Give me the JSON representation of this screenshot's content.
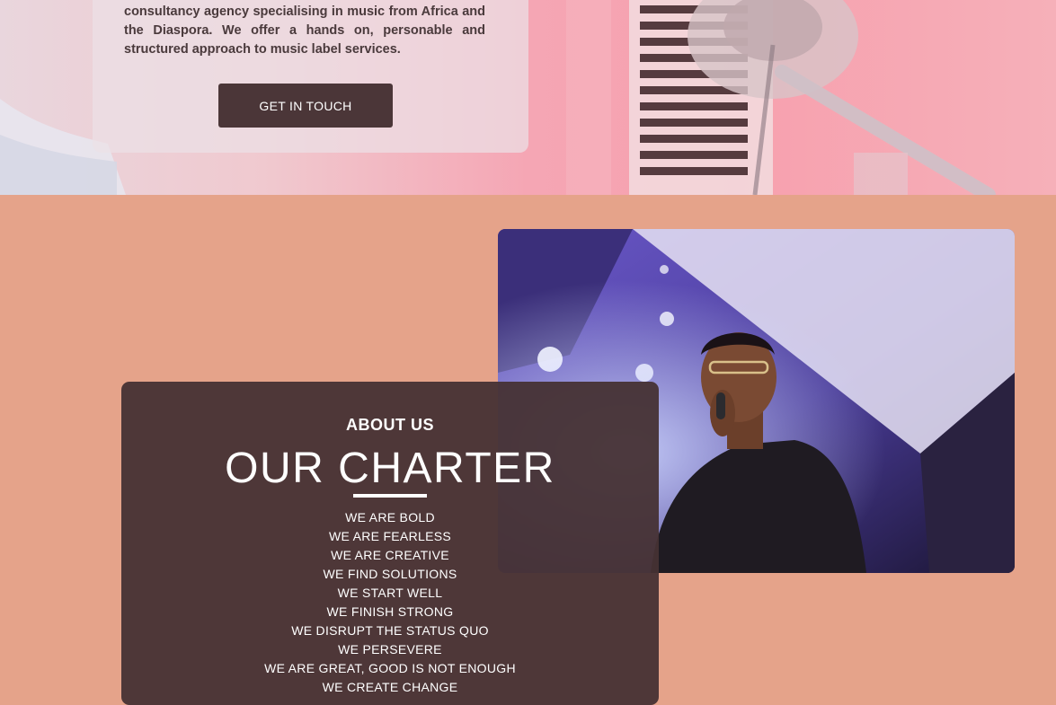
{
  "hero": {
    "intro_text": "consultancy agency specialising in music from Africa and the Diaspora. We offer a hands on, personable and structured approach to music label services.",
    "cta_label": "GET IN TOUCH"
  },
  "charter": {
    "eyebrow": "ABOUT US",
    "title": "OUR CHARTER",
    "values": [
      "WE ARE BOLD",
      "WE ARE FEARLESS",
      "WE ARE CREATIVE",
      "WE FIND SOLUTIONS",
      "WE START WELL",
      "WE FINISH STRONG",
      "WE DISRUPT THE STATUS QUO",
      "WE PERSEVERE",
      "WE ARE GREAT, GOOD IS NOT ENOUGH",
      "WE CREATE CHANGE"
    ]
  },
  "colors": {
    "section_background": "#e5a38a",
    "card_background": "#463234",
    "button_background": "#4b3638",
    "hero_tint": "#f5a6b4"
  }
}
